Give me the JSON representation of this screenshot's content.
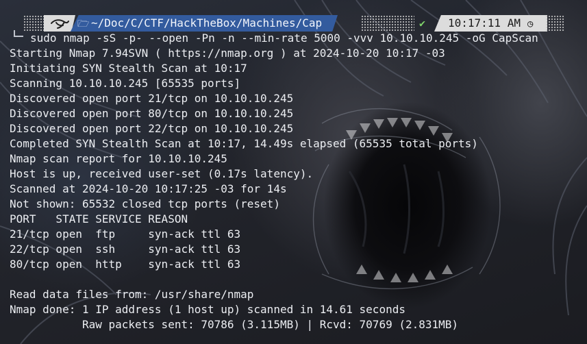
{
  "prompt": {
    "os_icon": "kali-dragon-icon",
    "folder_icon": "folder-icon",
    "path": "~/Doc/C/CTF/HackTheBox/Machines/Cap",
    "status_icon": "check-icon",
    "time": "10:17:11 AM",
    "time_icon": "clock-icon",
    "colors": {
      "path_segment": "#335b9e",
      "light_segment": "#dcdcdc",
      "check": "#7fd36a"
    }
  },
  "command": "sudo nmap -sS -p- --open -Pn -n --min-rate 5000 -vvv 10.10.10.245 -oG CapScan",
  "output": [
    "Starting Nmap 7.94SVN ( https://nmap.org ) at 2024-10-20 10:17 -03",
    "Initiating SYN Stealth Scan at 10:17",
    "Scanning 10.10.10.245 [65535 ports]",
    "Discovered open port 21/tcp on 10.10.10.245",
    "Discovered open port 80/tcp on 10.10.10.245",
    "Discovered open port 22/tcp on 10.10.10.245",
    "Completed SYN Stealth Scan at 10:17, 14.49s elapsed (65535 total ports)",
    "Nmap scan report for 10.10.10.245",
    "Host is up, received user-set (0.17s latency).",
    "Scanned at 2024-10-20 10:17:25 -03 for 14s",
    "Not shown: 65532 closed tcp ports (reset)",
    "PORT   STATE SERVICE REASON",
    "21/tcp open  ftp     syn-ack ttl 63",
    "22/tcp open  ssh     syn-ack ttl 63",
    "80/tcp open  http    syn-ack ttl 63",
    "",
    "Read data files from: /usr/share/nmap",
    "Nmap done: 1 IP address (1 host up) scanned in 14.61 seconds",
    "           Raw packets sent: 70786 (3.115MB) | Rcvd: 70769 (2.831MB)"
  ]
}
